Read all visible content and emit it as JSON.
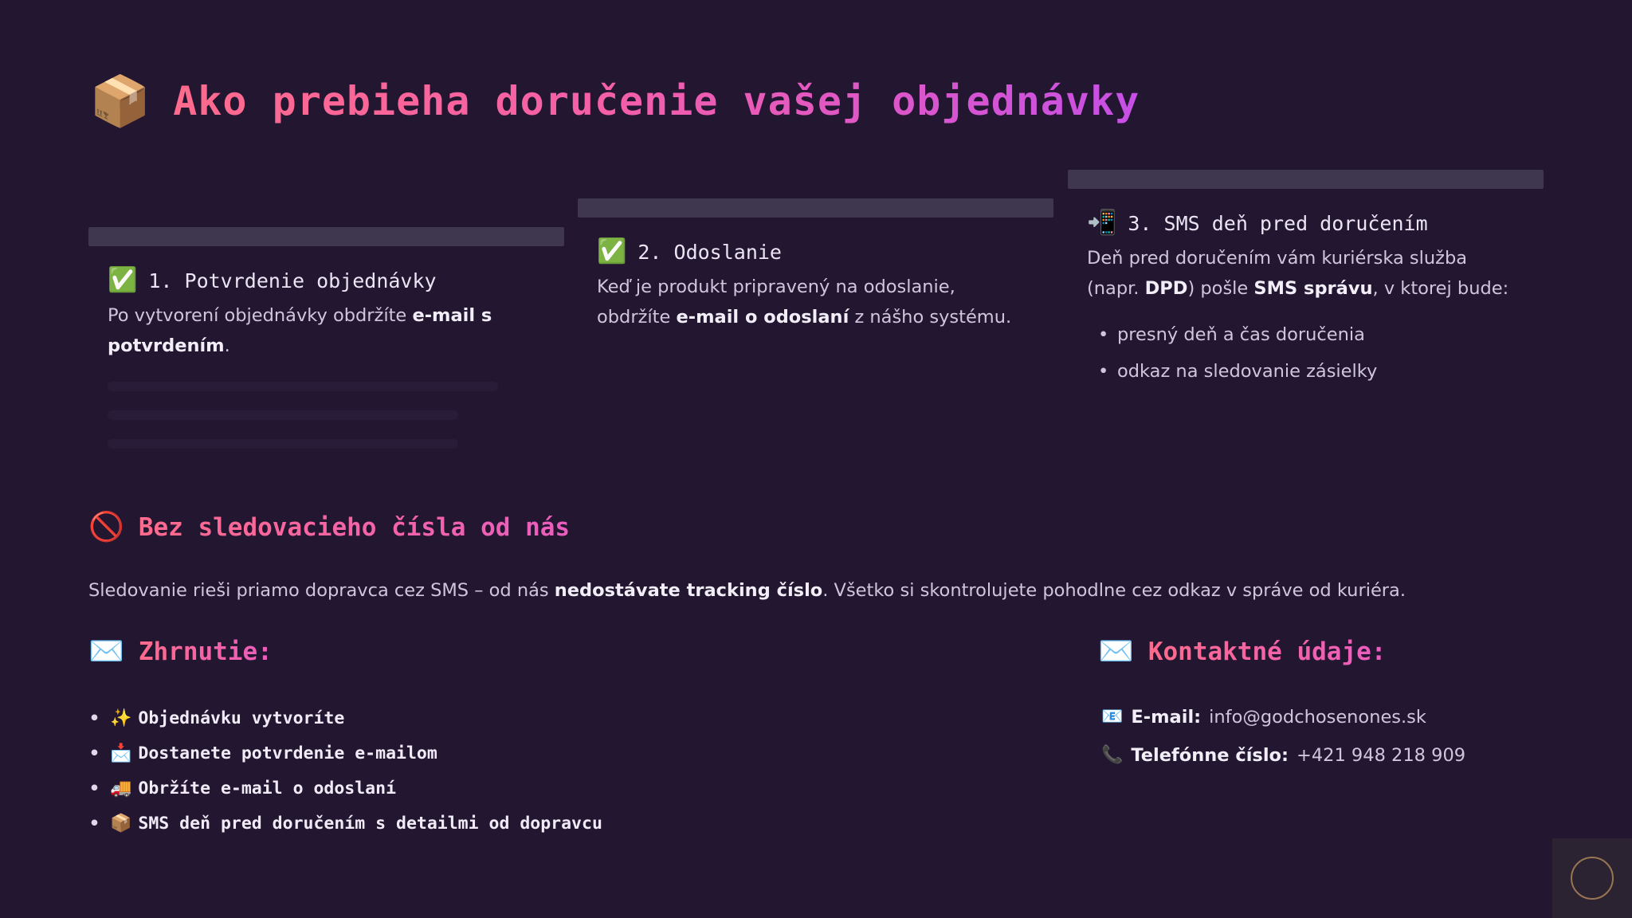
{
  "title": {
    "emoji": "📦",
    "text": "Ako prebieha doručenie vašej objednávky"
  },
  "steps": [
    {
      "icon": "✅",
      "title": "1. Potvrdenie objednávky",
      "text_before": "Po vytvorení objednávky obdržíte ",
      "text_bold": "e-mail s potvrdením",
      "text_after": "."
    },
    {
      "icon": "✅",
      "title": "2. Odoslanie",
      "text_before": "Keď je produkt pripravený na odoslanie, obdržíte ",
      "text_bold": "e-mail o odoslaní",
      "text_after": " z nášho systému."
    },
    {
      "icon": "📲",
      "title": "3. SMS deň pred doručením",
      "text_a": "Deň pred doručením vám kuriérska služba (napr. ",
      "text_b_bold": "DPD",
      "text_c": ") pošle ",
      "text_d_bold": "SMS správu",
      "text_e": ", v ktorej bude:",
      "bullets": [
        "presný deň a čas doručenia",
        "odkaz na sledovanie zásielky"
      ]
    }
  ],
  "no_tracking": {
    "icon": "🚫",
    "title": "Bez sledovacieho čísla od nás",
    "text_before": "Sledovanie rieši priamo dopravca cez SMS – od nás ",
    "text_bold": "nedostávate tracking číslo",
    "text_after": ". Všetko si skontrolujete pohodlne cez odkaz v správe od kuriéra."
  },
  "summary": {
    "icon": "✉️",
    "title": "Zhrnutie:",
    "items": [
      {
        "icon": "✨",
        "text": "Objednávku vytvoríte"
      },
      {
        "icon": "📩",
        "text": "Dostanete potvrdenie e-mailom"
      },
      {
        "icon": "🚚",
        "text": "Obržíte e-mail o odoslaní"
      },
      {
        "icon": "📦",
        "text": "SMS deň pred doručením s detailmi od dopravcu"
      }
    ]
  },
  "contact": {
    "icon": "✉️",
    "title": "Kontaktné údaje:",
    "email_icon": "📧",
    "email_label": "E-mail:",
    "email_value": "info@godchosenones.sk",
    "phone_icon": "📞",
    "phone_label": "Telefónne číslo:",
    "phone_value": "+421 948 218 909"
  },
  "colors": {
    "background": "#231631",
    "accent_start": "#ff6b8c",
    "accent_end": "#c74fe6",
    "card_bar": "#3f3650"
  }
}
